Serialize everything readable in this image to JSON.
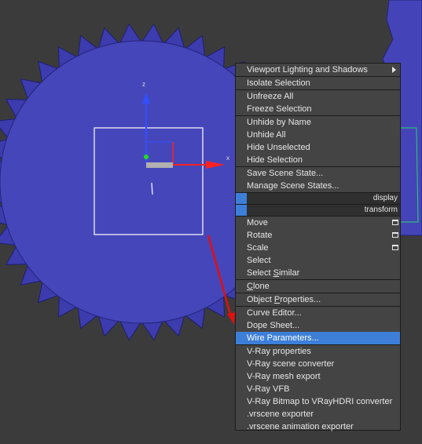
{
  "viewport": {
    "axis_labels": {
      "z": "z",
      "x": "x"
    },
    "colors": {
      "background": "#3b3b3b",
      "gear": "#4444b8",
      "gear_edge": "#22227a",
      "selection_box": "#ffffff",
      "red_axis": "#ff2222",
      "blue_axis": "#3050ff"
    }
  },
  "menu": {
    "highlight_color": "#3d7fd8",
    "items": {
      "viewport_lighting": "Viewport Lighting and Shadows",
      "isolate_selection": "Isolate Selection",
      "unfreeze_all": "Unfreeze All",
      "freeze_selection": "Freeze Selection",
      "unhide_by_name": "Unhide by Name",
      "unhide_all": "Unhide All",
      "hide_unselected": "Hide Unselected",
      "hide_selection": "Hide Selection",
      "save_scene_state": "Save Scene State...",
      "manage_scene_states": "Manage Scene States...",
      "quad_display": "display",
      "quad_transform": "transform",
      "move": "Move",
      "rotate": "Rotate",
      "scale": "Scale",
      "select": "Select",
      "select_similar_pre": "Select ",
      "select_similar_u": "S",
      "select_similar_post": "imilar",
      "clone_u": "C",
      "clone_post": "lone",
      "object_properties_pre": "Object ",
      "object_properties_u": "P",
      "object_properties_post": "roperties...",
      "curve_editor": "Curve Editor...",
      "dope_sheet": "Dope Sheet...",
      "wire_parameters": "Wire Parameters...",
      "vray_properties": "V-Ray properties",
      "vray_scene_converter": "V-Ray scene converter",
      "vray_mesh_export": "V-Ray mesh export",
      "vray_vfb": "V-Ray VFB",
      "vray_bitmap_converter": "V-Ray Bitmap to VRayHDRI converter",
      "vrscene_exporter": ".vrscene exporter",
      "vrscene_animation_exporter": ".vrscene animation exporter"
    }
  }
}
